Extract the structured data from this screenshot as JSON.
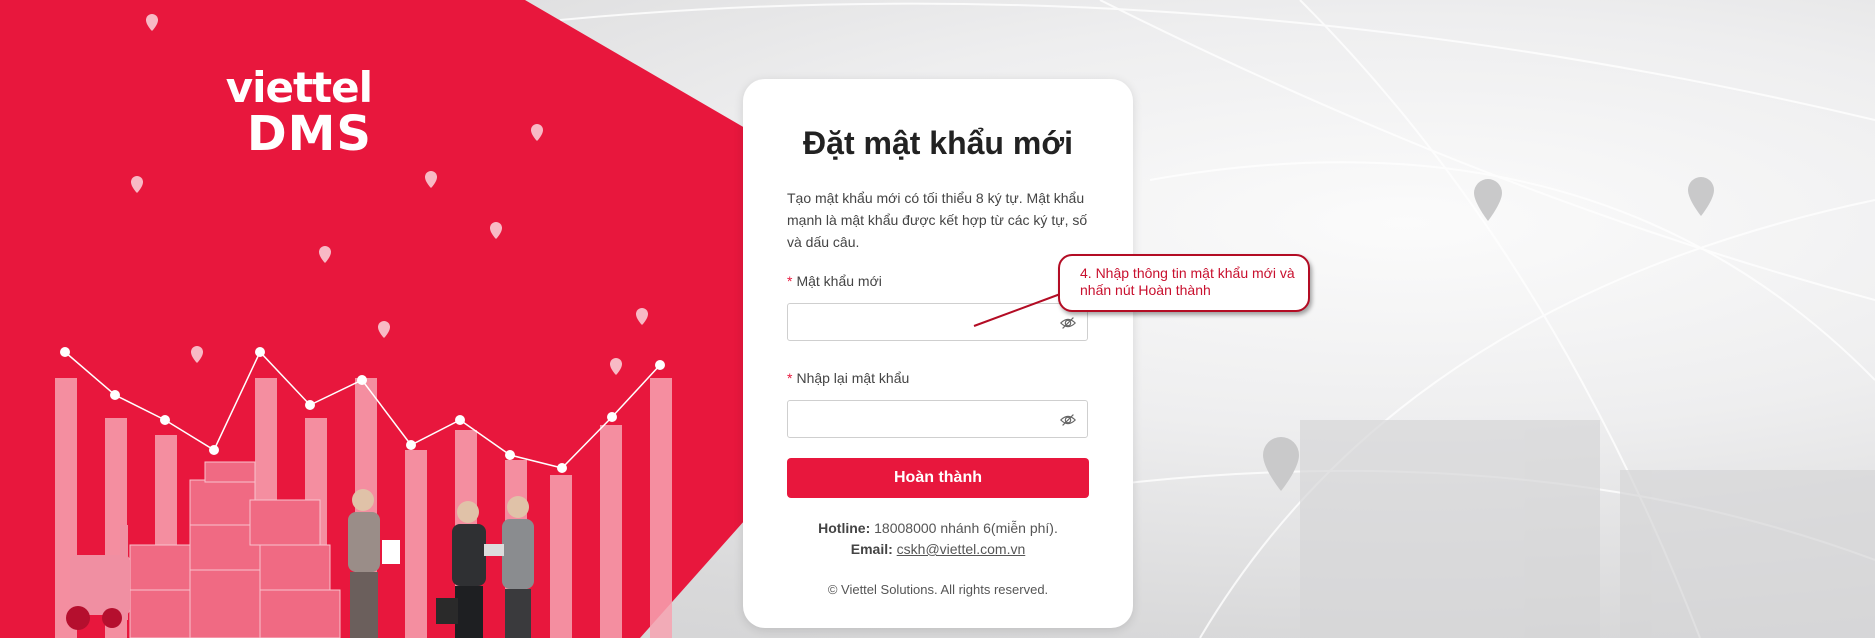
{
  "brand": {
    "logo_top": "viettel",
    "logo_bottom": "DMS"
  },
  "form": {
    "title": "Đặt mật khẩu mới",
    "description": "Tạo mật khẩu mới có tối thiểu 8 ký tự. Mật khẩu mạnh là mật khẩu được kết hợp từ các ký tự, số và dấu câu.",
    "required_mark": "*",
    "new_password_label": "Mật khẩu mới",
    "new_password_value": "",
    "confirm_password_label": "Nhập lại mật khẩu",
    "confirm_password_value": "",
    "submit_label": "Hoàn thành"
  },
  "contact": {
    "hotline_label": "Hotline:",
    "hotline_value": "18008000 nhánh 6(miễn phí).",
    "email_label": "Email:",
    "email_value": "cskh@viettel.com.vn"
  },
  "copyright": "© Viettel Solutions. All rights reserved.",
  "annotation": {
    "text": "4. Nhập thông tin mật khẩu mới và nhấn nút Hoàn thành"
  },
  "icons": {
    "password_toggle": "eye-slash-icon",
    "map_marker": "map-pin-icon"
  },
  "colors": {
    "brand_red": "#e8173d",
    "annotation_red": "#c8102e"
  }
}
